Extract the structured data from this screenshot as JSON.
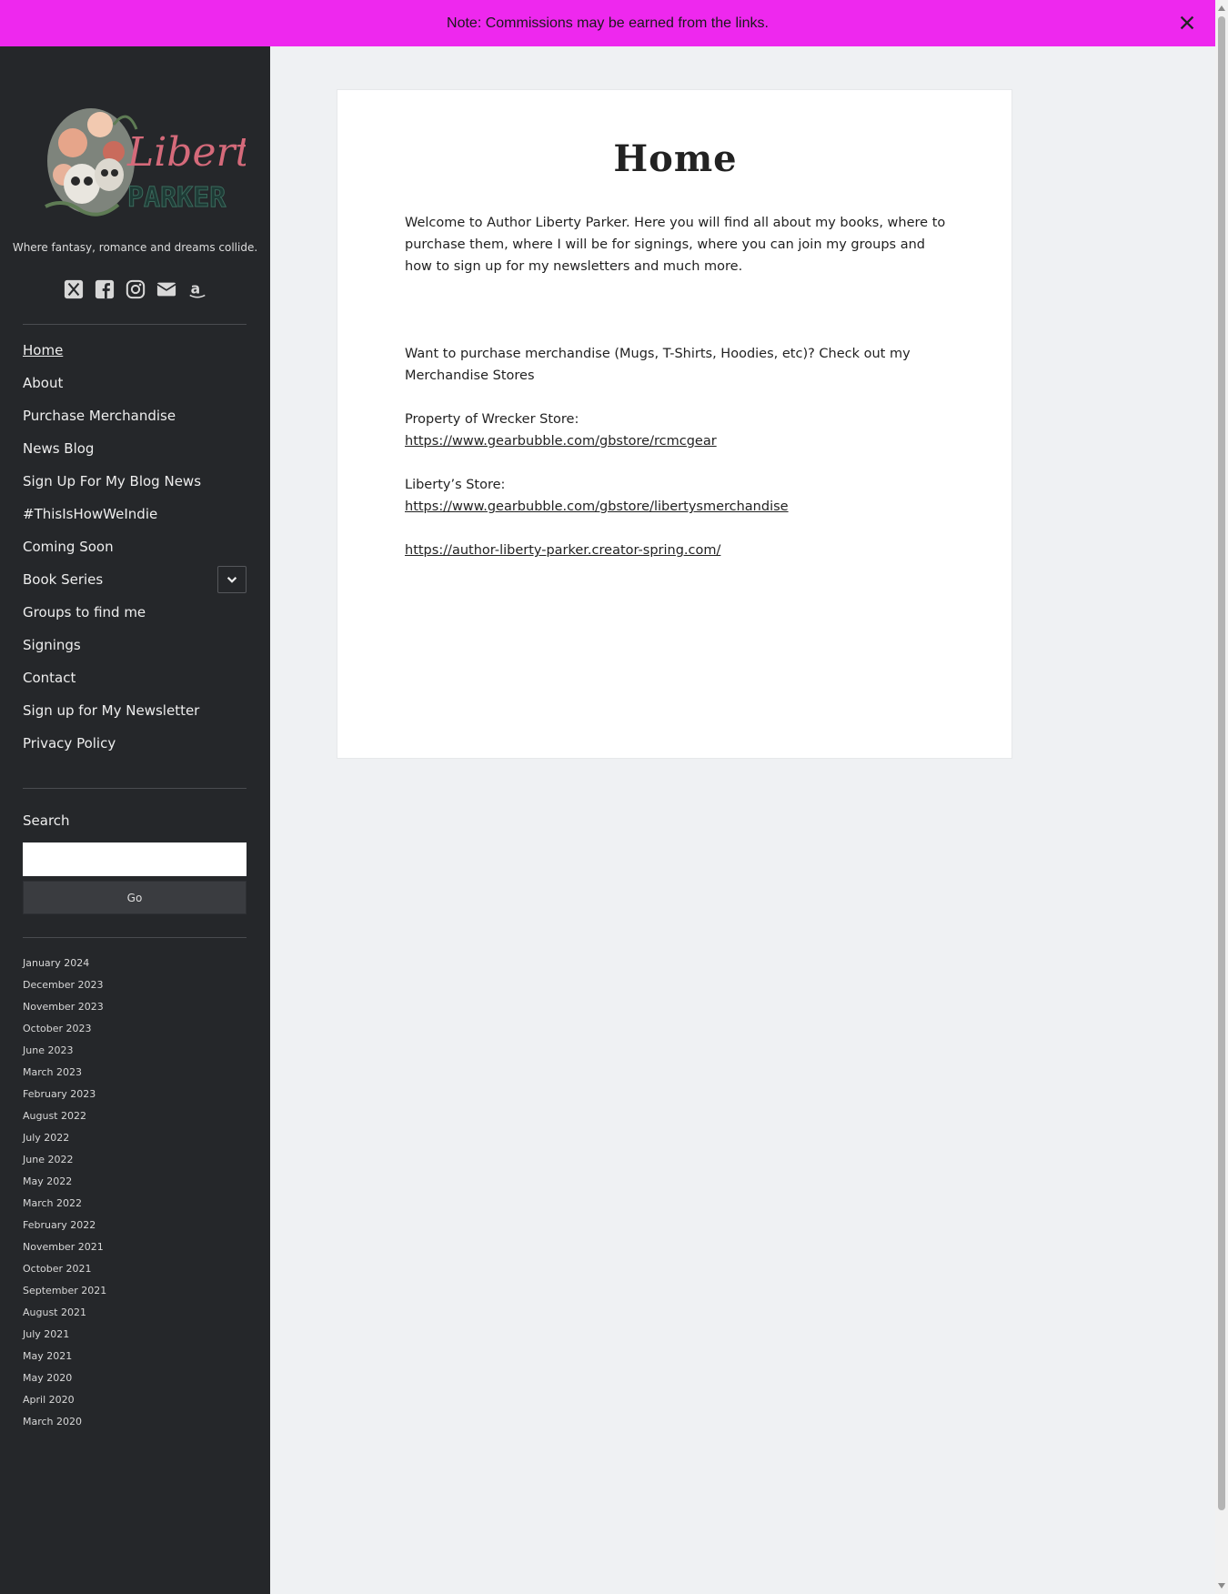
{
  "notice": {
    "text": "Note: Commissions may be earned from the links."
  },
  "sidebar": {
    "logo_text_line1": "Liberty",
    "logo_text_line2": "PARKER",
    "tagline": "Where fantasy, romance and dreams collide.",
    "social": [
      "x-icon",
      "facebook-icon",
      "instagram-icon",
      "email-icon",
      "amazon-icon"
    ],
    "nav": [
      "Home",
      "About",
      "Purchase Merchandise",
      "News Blog",
      "Sign Up For My Blog News",
      "#ThisIsHowWeIndie",
      "Coming Soon",
      "Book Series",
      "Groups to find me",
      "Signings",
      "Contact",
      "Sign up for My Newsletter",
      "Privacy Policy"
    ],
    "search": {
      "title": "Search",
      "input_value": "",
      "button": "Go"
    },
    "archives": [
      "January 2024",
      "December 2023",
      "November 2023",
      "October 2023",
      "June 2023",
      "March 2023",
      "February 2023",
      "August 2022",
      "July 2022",
      "June 2022",
      "May 2022",
      "March 2022",
      "February 2022",
      "November 2021",
      "October 2021",
      "September 2021",
      "August 2021",
      "July 2021",
      "May 2021",
      "May 2020",
      "April 2020",
      "March 2020"
    ]
  },
  "main": {
    "title": "Home",
    "intro": "Welcome to Author Liberty Parker.  Here you will find all about my books, where to purchase them, where I will be for signings, where you can join my groups and how to sign up for my  newsletters and much more.",
    "merch_intro": "Want to purchase merchandise (Mugs, T-Shirts, Hoodies, etc)?  Check out my Merchandise Stores",
    "store1_label": "Property of Wrecker Store:",
    "store1_link": "https://www.gearbubble.com/gbstore/rcmcgear",
    "store2_label": "Liberty’s Store:",
    "store2_link": "https://www.gearbubble.com/gbstore/libertysmerchandise",
    "store3_link": "https://author-liberty-parker.creator-spring.com/"
  },
  "colors": {
    "notice_bg": "#ee28ee",
    "sidebar_bg": "#25272a",
    "page_bg": "#eff1f3"
  }
}
